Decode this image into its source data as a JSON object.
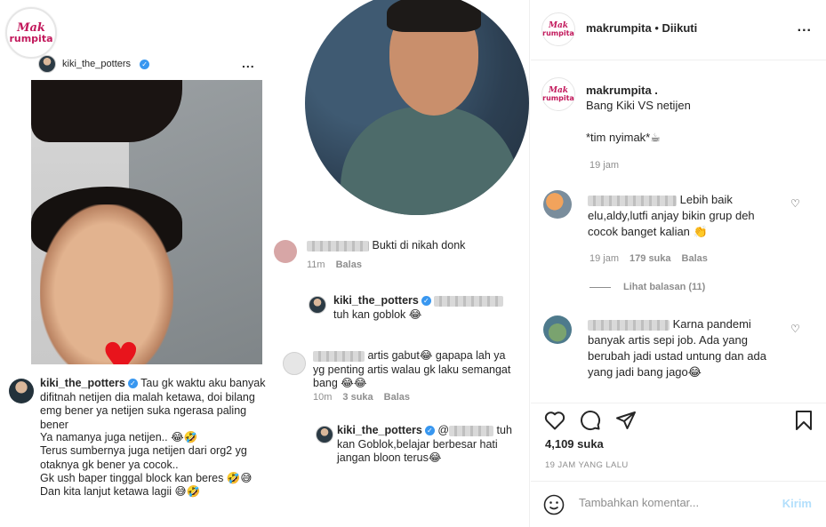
{
  "image": {
    "logo": {
      "mak": "Mak",
      "rumpita": "rumpita"
    },
    "post_header": {
      "username": "kiki_the_potters",
      "more": "..."
    },
    "main_comment": {
      "username": "kiki_the_potters",
      "text_1": "Tau gk waktu aku banyak difitnah netijen dia malah ketawa, doi bilang emg bener ya netijen suka ngerasa paling bener",
      "text_2": "Ya namanya juga netijen.. 😂🤣",
      "text_3": "Terus sumbernya juga netijen dari org2 yg otaknya gk bener ya cocok..",
      "text_4": "Gk ush baper tinggal block kan beres 🤣😅",
      "text_5": "Dan kita lanjut ketawa lagii 😅🤣"
    },
    "comment_a": {
      "text": "Bukti di nikah donk",
      "time": "11m",
      "reply": "Balas"
    },
    "reply_a": {
      "username": "kiki_the_potters",
      "text": "tuh kan goblok 😂"
    },
    "comment_b": {
      "text": "artis gabut😂 gapapa lah ya yg penting artis walau gk laku semangat bang 😂😂",
      "time": "10m",
      "likes": "3 suka",
      "reply": "Balas"
    },
    "reply_b": {
      "username": "kiki_the_potters",
      "text_mention": "@",
      "text": "tuh kan Goblok,belajar berbesar hati jangan bloon terus😂"
    }
  },
  "panel": {
    "header": {
      "account": "makrumpita",
      "separator": "•",
      "following": "Diikuti",
      "more": "..."
    },
    "caption": {
      "account": "makrumpita .",
      "line1": "Bang Kiki VS netijen",
      "line2": "*tim nyimak*☕",
      "time": "19 jam"
    },
    "comments": [
      {
        "text": "Lebih baik elu,aldy,lutfi anjay bikin grup deh cocok banget kalian 👏",
        "time": "19 jam",
        "likes": "179 suka",
        "reply": "Balas",
        "view_replies": "Lihat balasan (11)"
      },
      {
        "text": "Karna pandemi banyak artis sepi job. Ada yang berubah jadi ustad untung dan ada yang jadi bang jago😂"
      }
    ],
    "likes": "4,109 suka",
    "time_ago": "19 JAM YANG LALU",
    "add_comment": {
      "placeholder": "Tambahkan komentar...",
      "send": "Kirim"
    },
    "colors": {
      "verified": "#3897f0",
      "brand": "#c2185b",
      "send_disabled": "#b2dffc",
      "muted": "#8e8e8e"
    }
  }
}
